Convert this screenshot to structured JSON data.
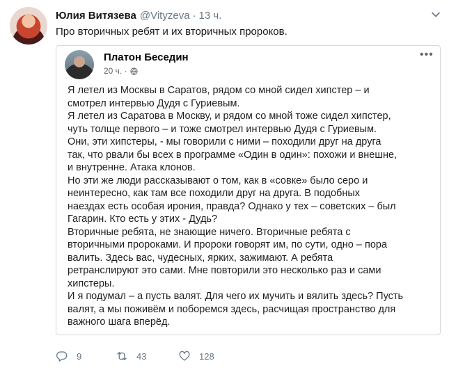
{
  "tweet": {
    "author_name": "Юлия Витязева",
    "author_handle": "@Vityzeva",
    "separator": "·",
    "time": "13 ч.",
    "text": "Про вторичных ребят и их вторичных пророков."
  },
  "embedded_post": {
    "author_name": "Платон Беседин",
    "time": "20 ч. ·",
    "more": "•••",
    "lines": [
      "Я летел из Москвы в Саратов, рядом со мной сидел хипстер – и",
      "смотрел интервью Дудя с Гуриевым.",
      "Я летел из Саратова в Москву, и рядом со мной тоже сидел хипстер,",
      "чуть толще первого – и тоже смотрел интервью Дудя с Гуриевым.",
      "Они, эти хипстеры, - мы говорили с ними – походили друг на друга",
      "так, что рвали бы всех в программе «Один в один»: похожи и внешне,",
      "и внутренне. Атака клонов.",
      "Но эти же люди рассказывают о том, как в «совке» было серо и",
      "неинтересно, как там все походили друг на друга. В подобных",
      "наездах есть особая ирония, правда? Однако у тех – советских – был",
      "Гагарин. Кто есть у этих - Дудь?",
      "Вторичные ребята, не знающие ничего. Вторичные ребята с",
      "вторичными пророками. И пророки говорят им, по сути, одно – пора",
      "валить. Здесь вас, чудесных, ярких, зажимают. А ребята",
      "ретранслируют это сами. Мне повторили это несколько раз и сами",
      "хипстеры.",
      "И я подумал – а пусть валят. Для чего их мучить и вялить здесь? Пусть",
      "валят, а мы поживём и поборемся здесь, расчищая пространство для",
      "важного шага вперёд."
    ]
  },
  "actions": {
    "replies": "9",
    "retweets": "43",
    "likes": "128"
  },
  "icons": {
    "reply": "reply-icon",
    "retweet": "retweet-icon",
    "like": "heart-icon",
    "chevron": "chevron-down-icon",
    "globe": "globe-icon"
  },
  "colors": {
    "secondary_text": "#657786",
    "primary_text": "#14171a",
    "border": "#d5d7dc"
  }
}
